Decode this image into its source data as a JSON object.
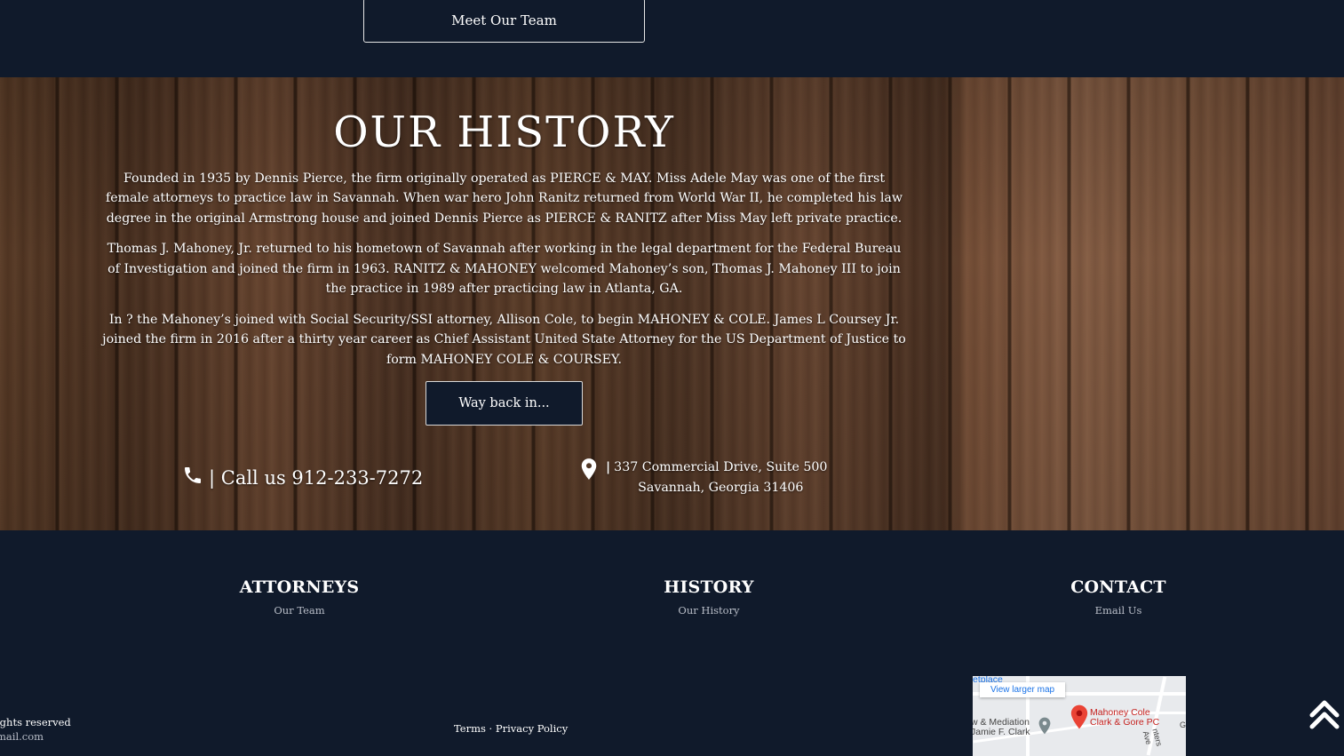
{
  "top": {
    "meet_button": "Meet Our Team"
  },
  "history": {
    "title": "OUR HISTORY",
    "paragraphs": [
      "Founded in 1935 by Dennis Pierce, the firm originally operated as PIERCE & MAY. Miss Adele May was one of the first female attorneys to practice law in Savannah. When war hero John Ranitz returned from World War II, he completed his law degree in the original Armstrong house and joined Dennis Pierce as PIERCE & RANITZ after Miss May left private practice.",
      "Thomas J. Mahoney, Jr. returned to his hometown of Savannah after working in the legal department for the Federal Bureau of Investigation and joined the firm in 1963. RANITZ & MAHONEY welcomed Mahoney’s son, Thomas J. Mahoney III to join the practice in 1989 after practicing law in Atlanta, GA.",
      "In ? the Mahoney’s joined with Social Security/SSI attorney, Allison Cole, to begin MAHONEY & COLE. James L Coursey Jr. joined the firm in 2016 after a thirty year career as Chief Assistant United State Attorney for the US Department of Justice to form MAHONEY COLE & COURSEY."
    ],
    "button": "Way back in..."
  },
  "contact_strip": {
    "call_label": "| Call us 912-233-7272",
    "address_line1": "337 Commercial Drive, Suite 500",
    "address_line2": "Savannah, Georgia 31406",
    "separator": "|"
  },
  "footer": {
    "columns": [
      {
        "heading": "ATTORNEYS",
        "link": "Our Team"
      },
      {
        "heading": "HISTORY",
        "link": "Our History"
      },
      {
        "heading": "CONTACT",
        "link": "Email Us"
      }
    ],
    "rights_line": "ights reserved",
    "email_fragment": "mail.com",
    "terms": "Terms",
    "dot": "·",
    "privacy": "Privacy Policy"
  },
  "map": {
    "larger_link": "View larger map",
    "label_top": "etplace",
    "label_left1": "w & Mediation",
    "label_left2": "Jamie F. Clark",
    "label_pin1": "Mahoney Cole",
    "label_pin2": "Clark & Gore PC",
    "label_street": "nters Ave",
    "label_edge": "G"
  },
  "icons": {
    "phone": "phone-icon",
    "pin": "map-pin-icon",
    "scroll_top": "double-chevron-up-icon"
  },
  "colors": {
    "navy": "#101a2b",
    "muted_link": "#b9bec8",
    "map_link": "#1a73e8",
    "map_pin": "#ea4335"
  }
}
